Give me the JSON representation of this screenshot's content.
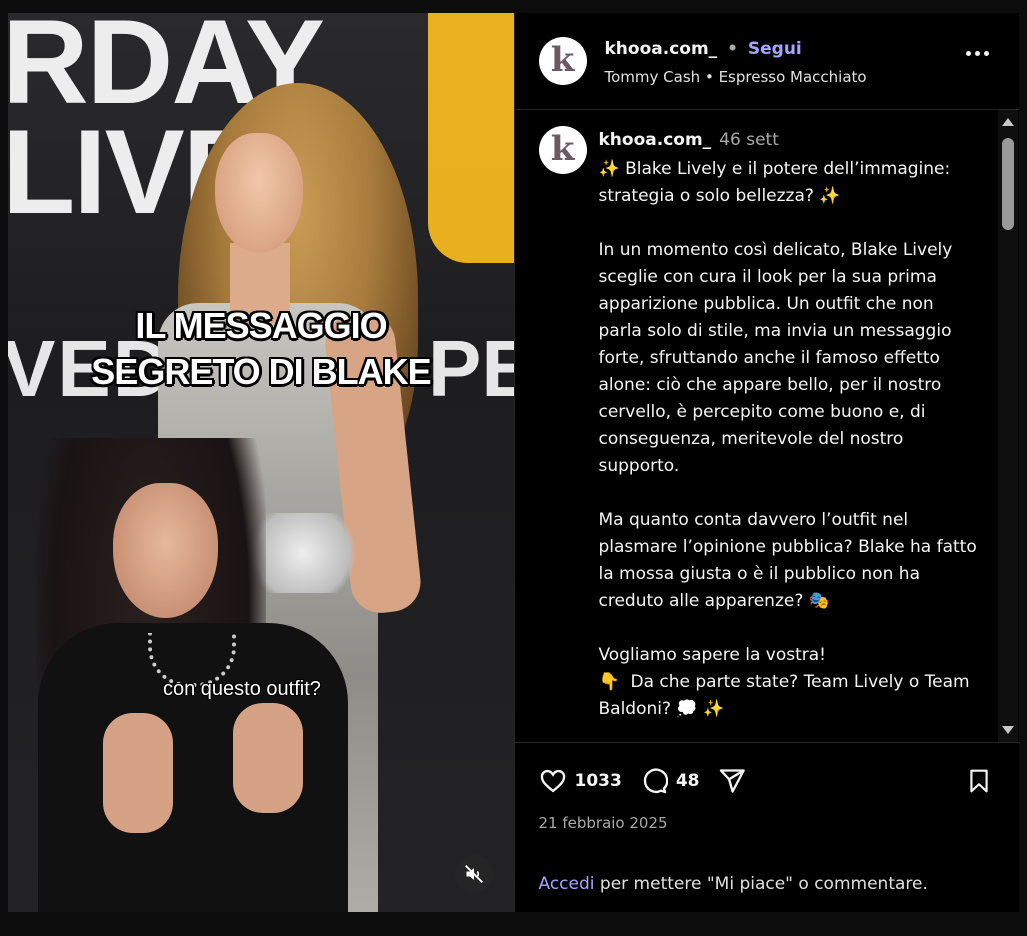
{
  "media": {
    "overlay_text": "IL MESSAGGIO\nSEGRETO DI BLAKE",
    "subtitle": "con questo outfit?",
    "background_text_rows": [
      "RDAY",
      "LIVE",
      "VED",
      "PEC"
    ],
    "mute_icon": "speaker-muted-icon"
  },
  "header": {
    "username": "khooa.com_",
    "separator": "•",
    "follow_label": "Segui",
    "audio_artist": "Tommy Cash",
    "audio_separator": "•",
    "audio_title": "Espresso Macchiato",
    "avatar_letter": "k",
    "more_icon": "more-options-icon"
  },
  "caption": {
    "username": "khooa.com_",
    "time": "46 sett",
    "text": "✨ Blake Lively e il potere dell’immagine: strategia o solo bellezza? ✨\n\nIn un momento così delicato, Blake Lively sceglie con cura il look per la sua prima apparizione pubblica. Un outfit che non parla solo di stile, ma invia un messaggio forte, sfruttando anche il famoso effetto alone: ciò che appare bello, per il nostro cervello, è percepito come buono e, di conseguenza, meritevole del nostro supporto.\n\nMa quanto conta davvero l’outfit nel plasmare l’opinione pubblica? Blake ha fatto la mossa giusta o è il pubblico non ha creduto alle apparenze? 🎭\n\nVogliamo sapere la vostra!\n👇  Da che parte state? Team Lively o Team Baldoni? 💭 ✨"
  },
  "actions": {
    "likes": "1033",
    "comments": "48",
    "date": "21 febbraio 2025",
    "login_link": "Accedi",
    "login_rest": " per mettere \"Mi piace\" o commentare."
  },
  "colors": {
    "accent_link": "#a3a6ff",
    "background": "#000000",
    "divider": "#262626"
  }
}
